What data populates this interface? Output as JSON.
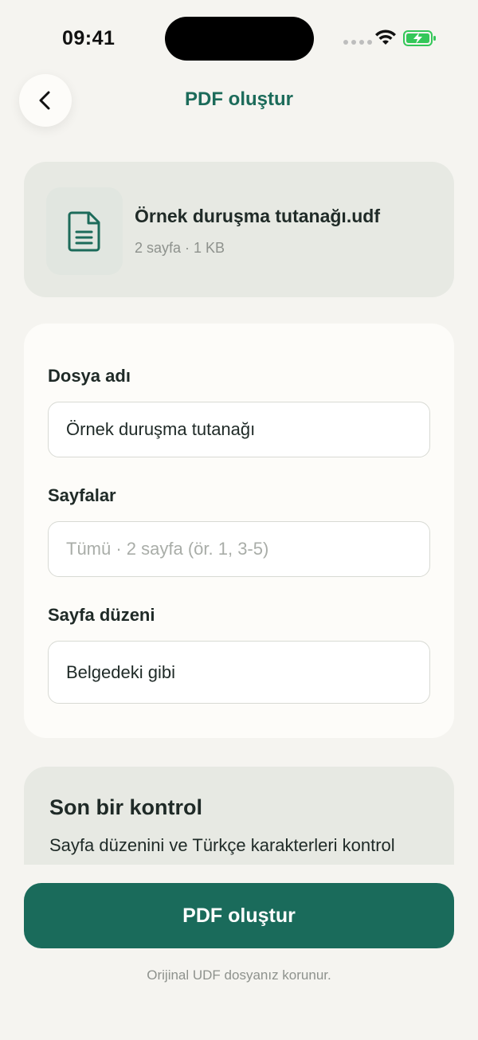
{
  "status_bar": {
    "time": "09:41"
  },
  "header": {
    "back_icon": "chevron-left-icon",
    "title": "PDF oluştur"
  },
  "file": {
    "icon": "document-icon",
    "name": "Örnek duruşma tutanağı.udf",
    "meta": "2 sayfa · 1 KB"
  },
  "form": {
    "file_name_label": "Dosya adı",
    "file_name_value": "Örnek duruşma tutanağı",
    "pages_label": "Sayfalar",
    "pages_placeholder": "Tümü · 2 sayfa (ör. 1, 3-5)",
    "layout_label": "Sayfa düzeni",
    "layout_value": "Belgedeki gibi"
  },
  "check": {
    "title": "Son bir kontrol",
    "text": "Sayfa düzenini ve Türkçe karakterleri kontrol"
  },
  "actions": {
    "primary_label": "PDF oluştur",
    "footnote": "Orijinal UDF dosyanız korunur."
  },
  "colors": {
    "accent": "#1A6B5B",
    "title_green": "#1C6B5A",
    "background": "#F5F4F0",
    "card_tint": "#E7E9E3"
  }
}
